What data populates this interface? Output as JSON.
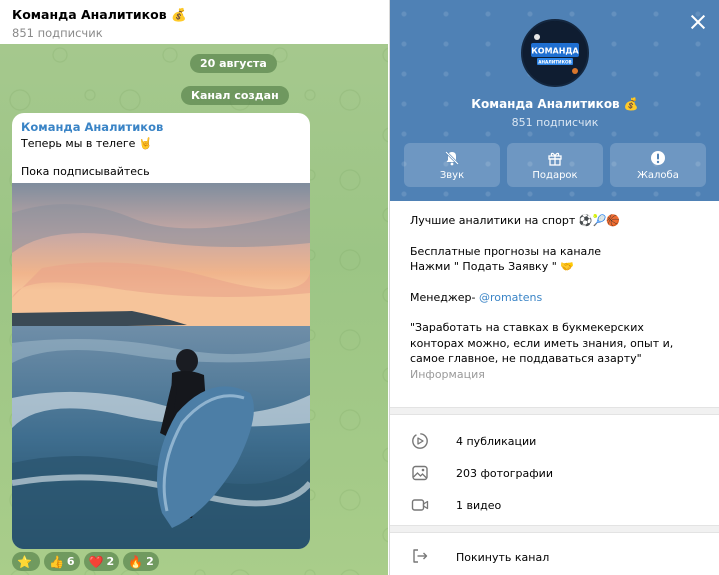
{
  "chat": {
    "title": "Команда Аналитиков 💰",
    "subscribers": "851 подписчик",
    "date_pill": "20 августа",
    "created_pill": "Канал создан",
    "message": {
      "author": "Команда Аналитиков",
      "line1": "Теперь мы в телеге 🤘",
      "line2": "Пока подписывайтесь"
    },
    "reactions": [
      {
        "emoji": "⭐",
        "count": ""
      },
      {
        "emoji": "👍",
        "count": "6"
      },
      {
        "emoji": "❤️",
        "count": "2"
      },
      {
        "emoji": "🔥",
        "count": "2"
      }
    ]
  },
  "panel": {
    "avatar_text_top": "КОМАНДА",
    "avatar_text_bottom": "АНАЛИТИКОВ",
    "title": "Команда Аналитиков 💰",
    "subscribers": "851 подписчик",
    "actions": [
      {
        "label": "Звук",
        "icon": "bell-muted-icon"
      },
      {
        "label": "Подарок",
        "icon": "gift-icon"
      },
      {
        "label": "Жалоба",
        "icon": "report-icon"
      }
    ],
    "about": {
      "line1": "Лучшие аналитики на спорт ⚽🎾🏀",
      "line2": "Бесплатные прогнозы на канале",
      "line3": "Нажми \" Подать Заявку \" 🤝",
      "manager_prefix": "Менеджер- ",
      "manager_link": "@romatens",
      "quote": "\"Заработать на ставках в букмекерских конторах можно, если иметь знания, опыт и, самое главное, не поддаваться азарту\"",
      "caption": "Информация"
    },
    "stats": [
      {
        "label": "4 публикации",
        "icon": "posts-icon"
      },
      {
        "label": "203 фотографии",
        "icon": "photo-icon"
      },
      {
        "label": "1 видео",
        "icon": "video-icon"
      }
    ],
    "leave_label": "Покинуть канал",
    "accent": "#4f81b5",
    "link_color": "#3a84c6"
  }
}
